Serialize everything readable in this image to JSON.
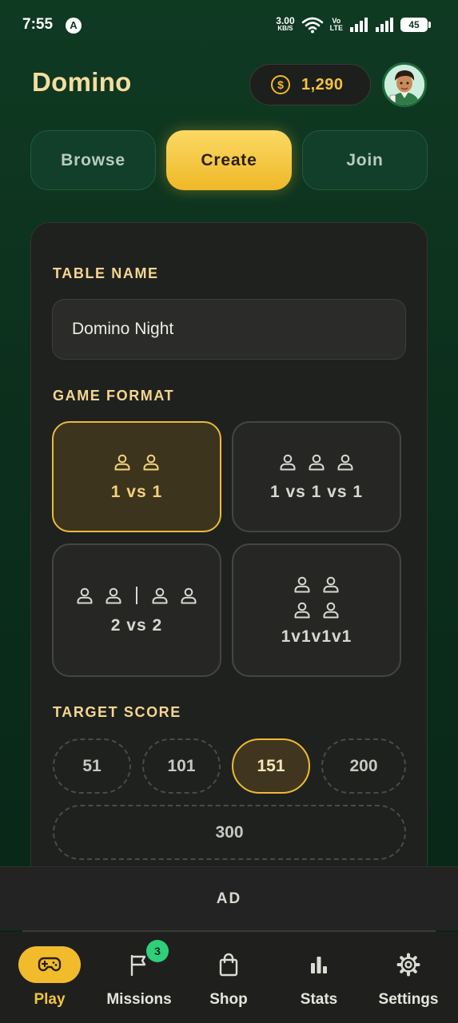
{
  "status_bar": {
    "time": "7:55",
    "notification_letter": "A",
    "net_speed_value": "3.00",
    "net_speed_unit": "KB/S",
    "volte_line1": "Vo",
    "volte_line2": "LTE",
    "battery": "45"
  },
  "header": {
    "title": "Domino",
    "coins": "1,290",
    "coin_symbol": "$"
  },
  "tabs": [
    {
      "label": "Browse",
      "active": false
    },
    {
      "label": "Create",
      "active": true
    },
    {
      "label": "Join",
      "active": false
    }
  ],
  "form": {
    "table_name_label": "TABLE NAME",
    "table_name_value": "Domino Night",
    "game_format_label": "GAME FORMAT",
    "formats": [
      {
        "label": "1 vs 1",
        "selected": true
      },
      {
        "label": "1 vs 1 vs 1",
        "selected": false
      },
      {
        "label": "2 vs 2",
        "selected": false
      },
      {
        "label": "1v1v1v1",
        "selected": false
      }
    ],
    "target_score_label": "TARGET SCORE",
    "scores": [
      {
        "label": "51",
        "selected": false
      },
      {
        "label": "101",
        "selected": false
      },
      {
        "label": "151",
        "selected": true
      },
      {
        "label": "200",
        "selected": false
      },
      {
        "label": "300",
        "selected": false
      }
    ]
  },
  "ad": {
    "label": "AD"
  },
  "nav": [
    {
      "label": "Play",
      "icon": "gamepad-icon",
      "active": true
    },
    {
      "label": "Missions",
      "icon": "flag-icon",
      "active": false,
      "badge": "3"
    },
    {
      "label": "Shop",
      "icon": "shopping-bag-icon",
      "active": false
    },
    {
      "label": "Stats",
      "icon": "bar-chart-icon",
      "active": false
    },
    {
      "label": "Settings",
      "icon": "gear-icon",
      "active": false
    }
  ],
  "colors": {
    "background": "#0e3620",
    "accent_gold": "#f1bb2c",
    "label_gold": "#f5d690",
    "card": "#1f211f",
    "badge_green": "#2ed07a"
  }
}
